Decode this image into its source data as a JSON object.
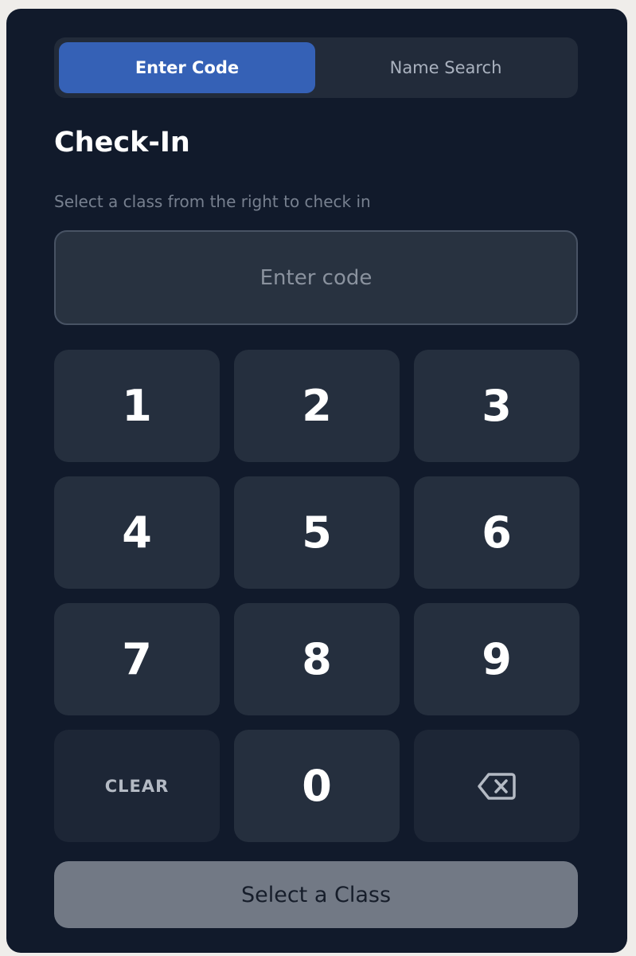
{
  "tabs": {
    "enter_code": "Enter Code",
    "name_search": "Name Search"
  },
  "checkin": {
    "title": "Check-In",
    "subtitle": "Select a class from the right to check in"
  },
  "code_input": {
    "placeholder": "Enter code",
    "value": ""
  },
  "keypad": {
    "k1": "1",
    "k2": "2",
    "k3": "3",
    "k4": "4",
    "k5": "5",
    "k6": "6",
    "k7": "7",
    "k8": "8",
    "k9": "9",
    "k0": "0",
    "clear": "CLEAR",
    "backspace_icon": "backspace-icon"
  },
  "submit": {
    "label": "Select a Class"
  },
  "colors": {
    "panel_bg": "#111a2b",
    "active_tab": "#3561b6",
    "key_bg": "#252f3e",
    "disabled_button": "#727985"
  }
}
